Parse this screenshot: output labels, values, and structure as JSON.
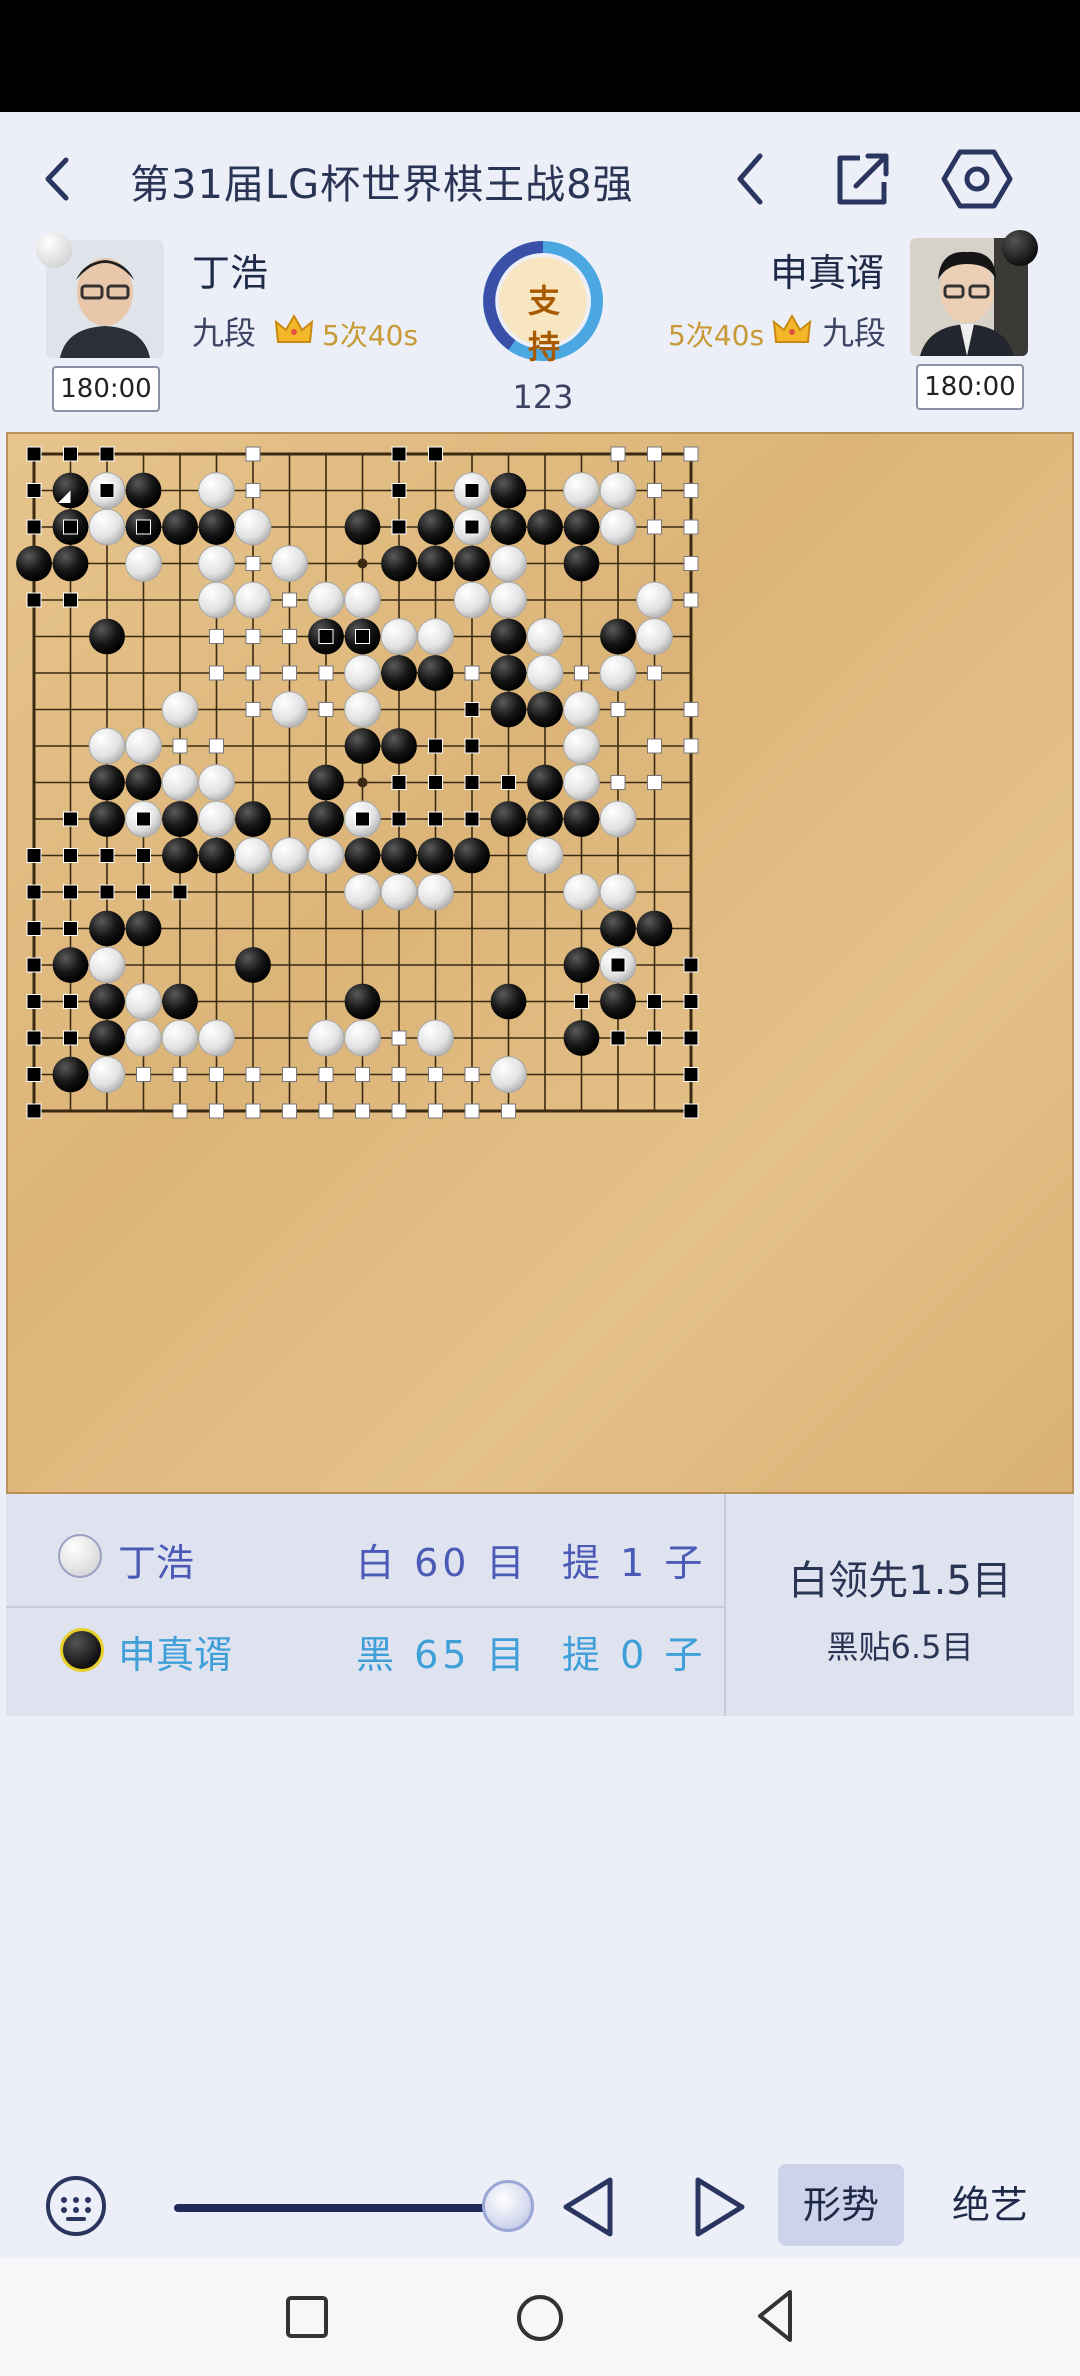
{
  "header": {
    "title": "第31届LG杯世界棋王战8强"
  },
  "players": {
    "white": {
      "name": "丁浩",
      "rank": "九段",
      "byoyomi": "5次40s",
      "clock": "180:00"
    },
    "black": {
      "name": "申真谞",
      "rank": "九段",
      "byoyomi": "5次40s",
      "clock": "180:00"
    }
  },
  "support": {
    "label": "支持",
    "move_number": "123"
  },
  "board": {
    "size": 19,
    "black_stones": [
      [
        1,
        1
      ],
      [
        3,
        1
      ],
      [
        1,
        2
      ],
      [
        3,
        2
      ],
      [
        4,
        2
      ],
      [
        5,
        2
      ],
      [
        0,
        3
      ],
      [
        1,
        3
      ],
      [
        2,
        5
      ],
      [
        2,
        9
      ],
      [
        3,
        9
      ],
      [
        2,
        10
      ],
      [
        4,
        10
      ],
      [
        4,
        11
      ],
      [
        5,
        11
      ],
      [
        6,
        10
      ],
      [
        2,
        13
      ],
      [
        3,
        13
      ],
      [
        1,
        14
      ],
      [
        6,
        14
      ],
      [
        2,
        15
      ],
      [
        4,
        15
      ],
      [
        2,
        16
      ],
      [
        1,
        17
      ],
      [
        13,
        1
      ],
      [
        9,
        2
      ],
      [
        11,
        2
      ],
      [
        13,
        2
      ],
      [
        14,
        2
      ],
      [
        15,
        2
      ],
      [
        10,
        3
      ],
      [
        11,
        3
      ],
      [
        12,
        3
      ],
      [
        15,
        3
      ],
      [
        8,
        5
      ],
      [
        9,
        5
      ],
      [
        13,
        5
      ],
      [
        16,
        5
      ],
      [
        10,
        6
      ],
      [
        11,
        6
      ],
      [
        13,
        6
      ],
      [
        13,
        7
      ],
      [
        14,
        7
      ],
      [
        9,
        8
      ],
      [
        10,
        8
      ],
      [
        8,
        9
      ],
      [
        14,
        9
      ],
      [
        8,
        10
      ],
      [
        13,
        10
      ],
      [
        14,
        10
      ],
      [
        15,
        10
      ],
      [
        9,
        11
      ],
      [
        10,
        11
      ],
      [
        11,
        11
      ],
      [
        12,
        11
      ],
      [
        16,
        13
      ],
      [
        17,
        13
      ],
      [
        15,
        14
      ],
      [
        16,
        15
      ],
      [
        9,
        15
      ],
      [
        13,
        15
      ],
      [
        15,
        16
      ]
    ],
    "white_stones": [
      [
        2,
        1
      ],
      [
        5,
        1
      ],
      [
        12,
        1
      ],
      [
        15,
        1
      ],
      [
        16,
        1
      ],
      [
        2,
        2
      ],
      [
        6,
        2
      ],
      [
        12,
        2
      ],
      [
        16,
        2
      ],
      [
        3,
        3
      ],
      [
        5,
        3
      ],
      [
        7,
        3
      ],
      [
        13,
        3
      ],
      [
        5,
        4
      ],
      [
        6,
        4
      ],
      [
        8,
        4
      ],
      [
        9,
        4
      ],
      [
        12,
        4
      ],
      [
        13,
        4
      ],
      [
        17,
        4
      ],
      [
        10,
        5
      ],
      [
        11,
        5
      ],
      [
        14,
        5
      ],
      [
        17,
        5
      ],
      [
        9,
        6
      ],
      [
        14,
        6
      ],
      [
        16,
        6
      ],
      [
        4,
        7
      ],
      [
        7,
        7
      ],
      [
        9,
        7
      ],
      [
        15,
        7
      ],
      [
        2,
        8
      ],
      [
        3,
        8
      ],
      [
        15,
        8
      ],
      [
        4,
        9
      ],
      [
        5,
        9
      ],
      [
        15,
        9
      ],
      [
        3,
        10
      ],
      [
        5,
        10
      ],
      [
        9,
        10
      ],
      [
        16,
        10
      ],
      [
        6,
        11
      ],
      [
        7,
        11
      ],
      [
        8,
        11
      ],
      [
        14,
        11
      ],
      [
        9,
        12
      ],
      [
        10,
        12
      ],
      [
        11,
        12
      ],
      [
        15,
        12
      ],
      [
        16,
        12
      ],
      [
        2,
        14
      ],
      [
        16,
        14
      ],
      [
        3,
        15
      ],
      [
        3,
        16
      ],
      [
        4,
        16
      ],
      [
        5,
        16
      ],
      [
        8,
        16
      ],
      [
        9,
        16
      ],
      [
        11,
        16
      ],
      [
        2,
        17
      ],
      [
        13,
        17
      ]
    ],
    "last_move": [
      1,
      1
    ],
    "black_territory": [
      [
        0,
        0
      ],
      [
        1,
        0
      ],
      [
        2,
        0
      ],
      [
        0,
        1
      ],
      [
        0,
        2
      ],
      [
        1,
        2
      ],
      [
        0,
        4
      ],
      [
        1,
        4
      ],
      [
        10,
        0
      ],
      [
        11,
        0
      ],
      [
        10,
        1
      ],
      [
        10,
        2
      ],
      [
        12,
        7
      ],
      [
        11,
        8
      ],
      [
        12,
        8
      ],
      [
        10,
        9
      ],
      [
        11,
        9
      ],
      [
        12,
        9
      ],
      [
        13,
        9
      ],
      [
        1,
        10
      ],
      [
        10,
        10
      ],
      [
        11,
        10
      ],
      [
        12,
        10
      ],
      [
        0,
        11
      ],
      [
        1,
        11
      ],
      [
        2,
        11
      ],
      [
        3,
        11
      ],
      [
        0,
        12
      ],
      [
        1,
        12
      ],
      [
        2,
        12
      ],
      [
        3,
        12
      ],
      [
        4,
        12
      ],
      [
        0,
        13
      ],
      [
        1,
        13
      ],
      [
        0,
        14
      ],
      [
        0,
        15
      ],
      [
        1,
        15
      ],
      [
        0,
        16
      ],
      [
        1,
        16
      ],
      [
        0,
        17
      ],
      [
        0,
        18
      ],
      [
        3,
        2
      ],
      [
        12,
        2
      ],
      [
        12,
        1
      ],
      [
        2,
        1
      ],
      [
        3,
        10
      ],
      [
        9,
        10
      ],
      [
        16,
        14
      ],
      [
        18,
        14
      ],
      [
        15,
        15
      ],
      [
        17,
        15
      ],
      [
        18,
        15
      ],
      [
        16,
        16
      ],
      [
        17,
        16
      ],
      [
        18,
        16
      ],
      [
        18,
        17
      ],
      [
        18,
        18
      ],
      [
        9,
        5
      ],
      [
        8,
        5
      ]
    ],
    "white_territory": [
      [
        6,
        0
      ],
      [
        16,
        0
      ],
      [
        17,
        0
      ],
      [
        18,
        0
      ],
      [
        6,
        1
      ],
      [
        17,
        1
      ],
      [
        18,
        1
      ],
      [
        17,
        2
      ],
      [
        18,
        2
      ],
      [
        6,
        3
      ],
      [
        18,
        3
      ],
      [
        7,
        4
      ],
      [
        18,
        4
      ],
      [
        5,
        5
      ],
      [
        6,
        5
      ],
      [
        7,
        5
      ],
      [
        5,
        6
      ],
      [
        6,
        6
      ],
      [
        7,
        6
      ],
      [
        8,
        6
      ],
      [
        12,
        6
      ],
      [
        15,
        6
      ],
      [
        17,
        6
      ],
      [
        6,
        7
      ],
      [
        18,
        7
      ],
      [
        8,
        7
      ],
      [
        16,
        7
      ],
      [
        4,
        8
      ],
      [
        5,
        8
      ],
      [
        17,
        8
      ],
      [
        18,
        8
      ],
      [
        16,
        9
      ],
      [
        17,
        9
      ],
      [
        10,
        16
      ],
      [
        3,
        17
      ],
      [
        4,
        17
      ],
      [
        5,
        17
      ],
      [
        6,
        17
      ],
      [
        7,
        17
      ],
      [
        8,
        17
      ],
      [
        9,
        17
      ],
      [
        10,
        17
      ],
      [
        11,
        17
      ],
      [
        12,
        17
      ],
      [
        4,
        18
      ],
      [
        5,
        18
      ],
      [
        6,
        18
      ],
      [
        7,
        18
      ],
      [
        8,
        18
      ],
      [
        9,
        18
      ],
      [
        10,
        18
      ],
      [
        11,
        18
      ],
      [
        12,
        18
      ],
      [
        13,
        18
      ]
    ]
  },
  "score": {
    "white_name": "丁浩",
    "white_area": "白 60 目",
    "white_captures": "提 1 子",
    "black_name": "申真谞",
    "black_area": "黑 65 目",
    "black_captures": "提 0 子",
    "lead": "白领先1.5目",
    "komi": "黑贴6.5目"
  },
  "controls": {
    "form_label": "形势",
    "skill_label": "绝艺",
    "slider_progress": 1.0
  }
}
